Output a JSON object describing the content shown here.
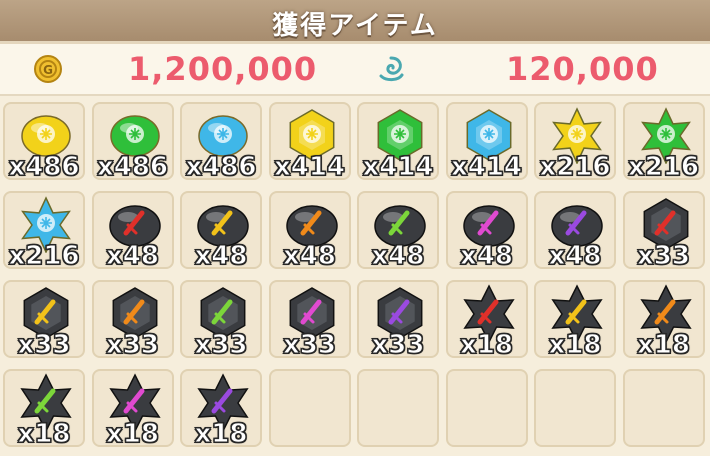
{
  "header": {
    "title": "獲得アイテム"
  },
  "currencies": [
    {
      "icon": "gold-coin-icon",
      "value": "1,200,000",
      "color": "#e6b825"
    },
    {
      "icon": "spirit-swirl-icon",
      "value": "120,000",
      "color": "#5cb6b8"
    }
  ],
  "items": [
    {
      "icon": "yellow-orb-gem-icon",
      "shape": "blob",
      "color": "#f2d21a",
      "qty": "x486"
    },
    {
      "icon": "green-orb-gem-icon",
      "shape": "blob",
      "color": "#2fbf3a",
      "qty": "x486"
    },
    {
      "icon": "blue-orb-gem-icon",
      "shape": "blob",
      "color": "#3fb7e8",
      "qty": "x486"
    },
    {
      "icon": "yellow-hex-gem-icon",
      "shape": "hex",
      "color": "#f2d21a",
      "qty": "x414"
    },
    {
      "icon": "green-hex-gem-icon",
      "shape": "hex",
      "color": "#2fbf3a",
      "qty": "x414"
    },
    {
      "icon": "blue-hex-gem-icon",
      "shape": "hex",
      "color": "#3fb7e8",
      "qty": "x414"
    },
    {
      "icon": "yellow-star-gem-icon",
      "shape": "star",
      "color": "#f2d21a",
      "qty": "x216"
    },
    {
      "icon": "green-star-gem-icon",
      "shape": "star",
      "color": "#2fbf3a",
      "qty": "x216"
    },
    {
      "icon": "blue-star-gem-icon",
      "shape": "star",
      "color": "#3fb7e8",
      "qty": "x216"
    },
    {
      "icon": "red-sword-black-stone-icon",
      "shape": "darkblob",
      "color": "#e0302a",
      "qty": "x48"
    },
    {
      "icon": "yellow-glove-black-stone-icon",
      "shape": "darkblob",
      "color": "#f2c21a",
      "qty": "x48"
    },
    {
      "icon": "orange-bow-black-stone-icon",
      "shape": "darkblob",
      "color": "#f08a1a",
      "qty": "x48"
    },
    {
      "icon": "green-claw-black-stone-icon",
      "shape": "darkblob",
      "color": "#7cd63a",
      "qty": "x48"
    },
    {
      "icon": "pink-crystal-black-stone-icon",
      "shape": "darkblob",
      "color": "#e04ad0",
      "qty": "x48"
    },
    {
      "icon": "purple-staff-black-stone-icon",
      "shape": "darkblob",
      "color": "#9a4ae0",
      "qty": "x48"
    },
    {
      "icon": "red-sword-black-hex-icon",
      "shape": "darkhex",
      "color": "#e0302a",
      "qty": "x33"
    },
    {
      "icon": "yellow-glove-black-hex-icon",
      "shape": "darkhex",
      "color": "#f2c21a",
      "qty": "x33"
    },
    {
      "icon": "orange-bow-black-hex-icon",
      "shape": "darkhex",
      "color": "#f08a1a",
      "qty": "x33"
    },
    {
      "icon": "green-claw-black-hex-icon",
      "shape": "darkhex",
      "color": "#7cd63a",
      "qty": "x33"
    },
    {
      "icon": "pink-crystal-black-hex-icon",
      "shape": "darkhex",
      "color": "#e04ad0",
      "qty": "x33"
    },
    {
      "icon": "purple-staff-black-hex-icon",
      "shape": "darkhex",
      "color": "#9a4ae0",
      "qty": "x33"
    },
    {
      "icon": "red-sword-black-star-icon",
      "shape": "darkstar",
      "color": "#e0302a",
      "qty": "x18"
    },
    {
      "icon": "yellow-glove-black-star-icon",
      "shape": "darkstar",
      "color": "#f2c21a",
      "qty": "x18"
    },
    {
      "icon": "orange-bow-black-star-icon",
      "shape": "darkstar",
      "color": "#f08a1a",
      "qty": "x18"
    },
    {
      "icon": "green-claw-black-star-icon",
      "shape": "darkstar",
      "color": "#7cd63a",
      "qty": "x18"
    },
    {
      "icon": "pink-crystal-black-star-icon",
      "shape": "darkstar",
      "color": "#e04ad0",
      "qty": "x18"
    },
    {
      "icon": "purple-staff-black-star-icon",
      "shape": "darkstar",
      "color": "#9a4ae0",
      "qty": "x18"
    },
    {
      "icon": "",
      "shape": "empty",
      "color": "",
      "qty": ""
    },
    {
      "icon": "",
      "shape": "empty",
      "color": "",
      "qty": ""
    },
    {
      "icon": "",
      "shape": "empty",
      "color": "",
      "qty": ""
    },
    {
      "icon": "",
      "shape": "empty",
      "color": "",
      "qty": ""
    },
    {
      "icon": "",
      "shape": "empty",
      "color": "",
      "qty": ""
    }
  ]
}
